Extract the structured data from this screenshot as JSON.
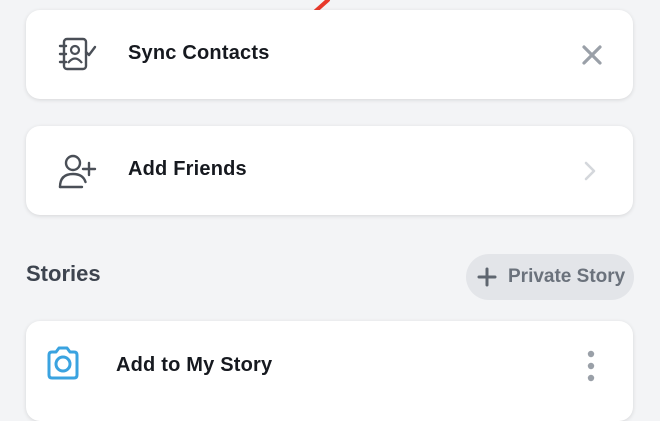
{
  "cards": {
    "sync_contacts": {
      "label": "Sync Contacts",
      "icon": "contacts-book-check-icon",
      "action_icon": "close-icon"
    },
    "add_friends": {
      "label": "Add Friends",
      "icon": "add-person-icon",
      "action_icon": "chevron-right-icon"
    },
    "add_to_story": {
      "label": "Add to My Story",
      "icon": "camera-icon",
      "action_icon": "more-vertical-icon"
    }
  },
  "stories": {
    "title": "Stories",
    "private_story_label": "Private Story",
    "private_story_icon": "plus-icon"
  },
  "colors": {
    "background": "#f3f4f6",
    "card": "#ffffff",
    "accent_blue": "#3aa3e0",
    "annotation_red": "#e8392b"
  }
}
